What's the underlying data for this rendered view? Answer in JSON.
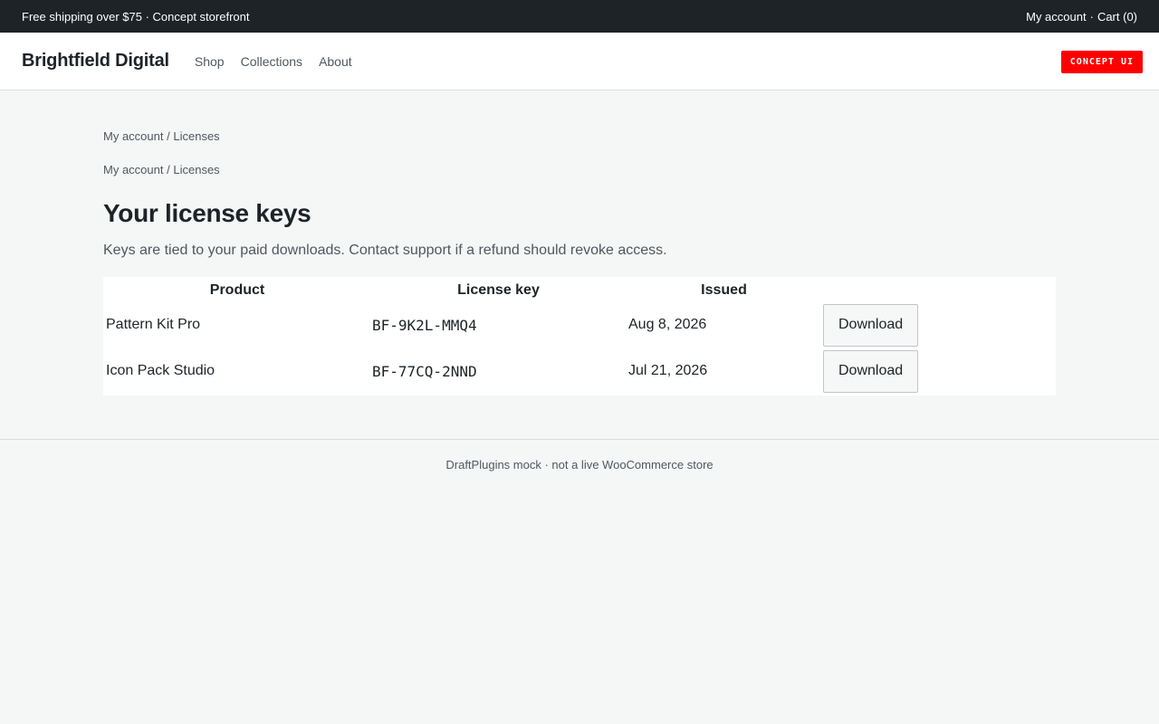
{
  "topbar": {
    "promo": "Free shipping over $75 · Concept storefront",
    "account_link": "My account",
    "separator": "·",
    "cart_link": "Cart (0)"
  },
  "header": {
    "brand": "Brightfield Digital",
    "nav": [
      "Shop",
      "Collections",
      "About"
    ],
    "badge": "CONCEPT UI",
    "badge_color": "#ff0000"
  },
  "breadcrumb": {
    "account": "My account",
    "separator": "/",
    "current": "Licenses"
  },
  "page": {
    "title": "Your license keys",
    "lede": "Keys are tied to your paid downloads. Contact support if a refund should revoke access."
  },
  "table": {
    "headers": [
      "Product",
      "License key",
      "Issued",
      ""
    ],
    "rows": [
      {
        "product": "Pattern Kit Pro",
        "key": "BF-9K2L-MMQ4",
        "issued": "Aug 8, 2026",
        "action": "Download"
      },
      {
        "product": "Icon Pack Studio",
        "key": "BF-77CQ-2NND",
        "issued": "Jul 21, 2026",
        "action": "Download"
      }
    ]
  },
  "footer": {
    "text": "DraftPlugins mock · not a live WooCommerce store"
  }
}
